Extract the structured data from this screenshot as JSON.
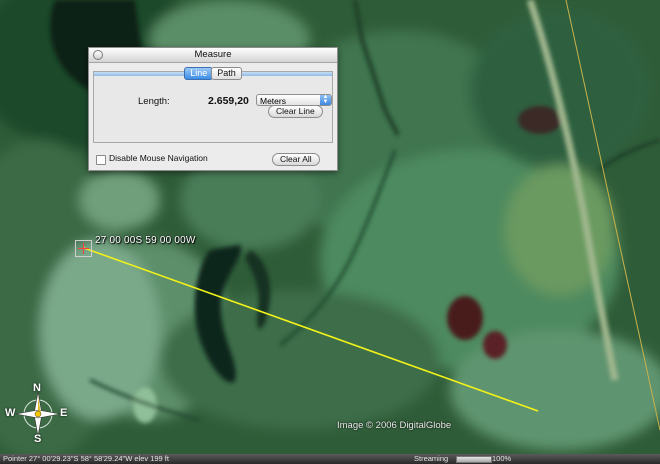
{
  "map": {
    "placemark_label": "27 00 00S 59 00 00W",
    "copyright": "Image © 2006 DigitalGlobe",
    "measure_line_color": "#f2f21a",
    "compass": {
      "n": "N",
      "s": "S",
      "e": "E",
      "w": "W"
    }
  },
  "dialog": {
    "title": "Measure",
    "tabs": [
      {
        "label": "Line",
        "active": true
      },
      {
        "label": "Path",
        "active": false
      }
    ],
    "length_label": "Length:",
    "length_value": "2.659,20",
    "units_selected": "Meters",
    "clear_line_label": "Clear Line",
    "clear_all_label": "Clear All",
    "disable_nav_label": "Disable Mouse Navigation",
    "disable_nav_checked": false
  },
  "status": {
    "pointer_text": "Pointer 27° 00'29.23\"S    58° 58'29.24\"W    elev   199 ft",
    "streaming_label": "Streaming",
    "streaming_percent": "100%",
    "streaming_fraction": 1.0
  }
}
